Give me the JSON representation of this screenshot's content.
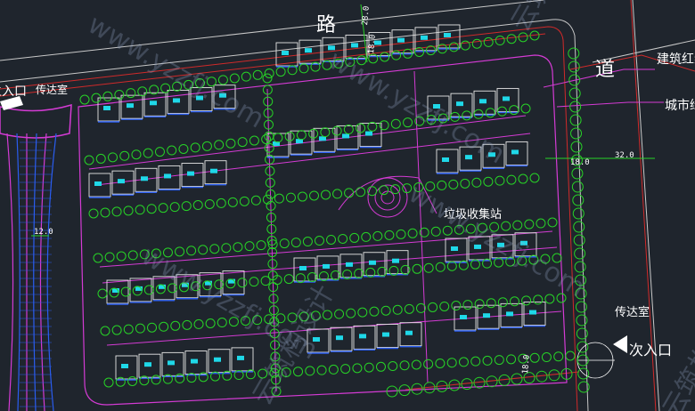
{
  "labels": {
    "road_char_1": "路",
    "road_char_2": "道",
    "building_line": "建筑红线",
    "city_line": "城市绿线",
    "main_entrance": "主入口",
    "guard_room_top": "传达室",
    "guard_room_bottom": "传达室",
    "secondary_entrance": "次入口",
    "garbage_station": "垃圾收集站"
  },
  "dimensions": {
    "road_top": "28.0",
    "setback_top": "18.0",
    "road_right": "32.0",
    "setback_right": "18.0",
    "boulevard_width": "12.0",
    "setback_bottom": "18.0"
  },
  "watermark": {
    "text": "www.yzzfj.com",
    "brand_chars": "云筑构设计"
  },
  "colors": {
    "background": "#1f252d",
    "magenta": "#d43bd4",
    "green_tree": "#27d327",
    "cyan": "#1fd8e8",
    "blue": "#2a5df0",
    "red_line": "#d02a2a",
    "white": "#ffffff"
  }
}
